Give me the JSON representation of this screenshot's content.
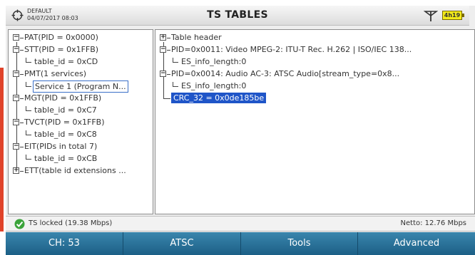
{
  "header": {
    "profile_name": "DEFAULT",
    "datetime": "04/07/2017 08:03",
    "title": "TS TABLES",
    "battery": "4h19"
  },
  "left_tree": {
    "pat": "PAT(PID = 0x0000)",
    "stt": "STT(PID = 0x1FFB)",
    "stt_table_id": "table_id = 0xCD",
    "pmt": "PMT(1 services)",
    "pmt_service": "Service 1 (Program N...",
    "mgt": "MGT(PID = 0x1FFB)",
    "mgt_table_id": "table_id = 0xC7",
    "tvct": "TVCT(PID = 0x1FFB)",
    "tvct_table_id": "table_id = 0xC8",
    "eit": "EIT(PIDs in total 7)",
    "eit_table_id": "table_id = 0xCB",
    "ett": "ETT(table id extensions ..."
  },
  "right_tree": {
    "table_header": "Table header",
    "pid_video": "PID=0x0011: Video MPEG-2: ITU-T Rec. H.262 | ISO/IEC 138...",
    "video_es_info": "ES_info_length:0",
    "pid_audio": "PID=0x0014: Audio AC-3: ATSC Audio[stream_type=0x8...",
    "audio_es_info": "ES_info_length:0",
    "crc": "CRC_32 = 0x0de185be"
  },
  "status": {
    "lock_text": "TS locked (19.38 Mbps)",
    "netto": "Netto: 12.76 Mbps"
  },
  "bottom_bar": {
    "channel": "CH: 53",
    "standard": "ATSC",
    "tools": "Tools",
    "advanced": "Advanced"
  },
  "colors": {
    "selection": "#1f55c8",
    "bottom_bar": "#2a749c",
    "battery": "#f2ea1a",
    "status_ok": "#3aa33a"
  }
}
